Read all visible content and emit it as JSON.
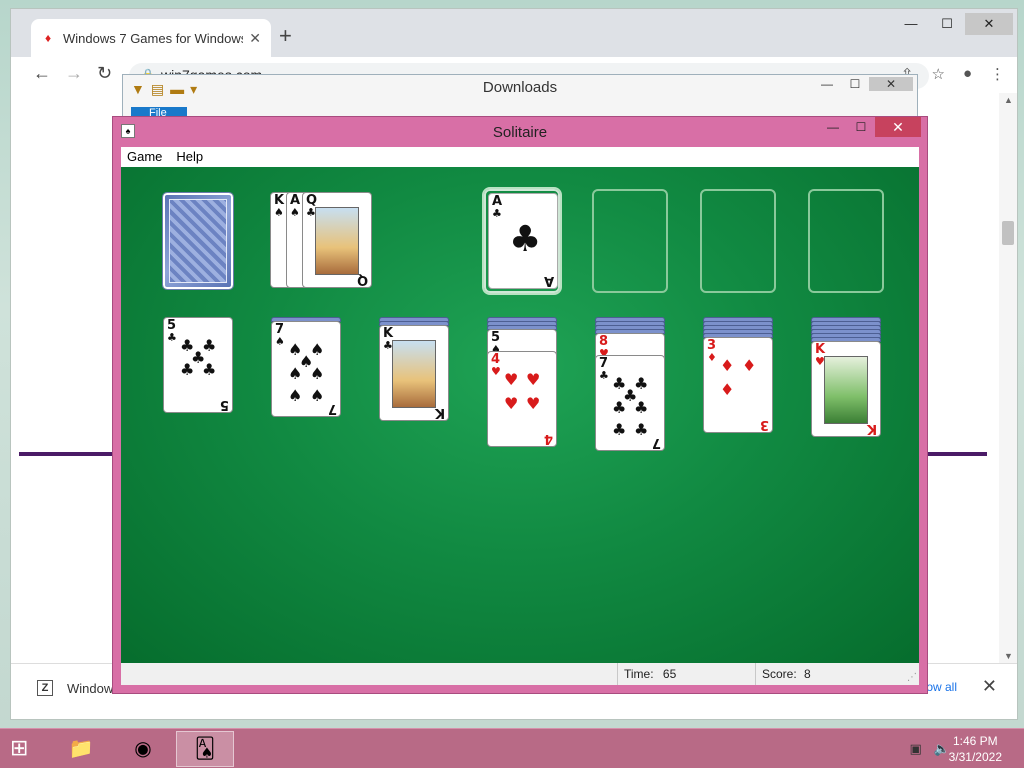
{
  "browser": {
    "tab_title": "Windows 7 Games for Windows",
    "tab_close": "✕",
    "new_tab": "+",
    "url": "win7games.com",
    "download_item": "Windows",
    "show_all": "Show all",
    "download_close": "✕"
  },
  "explorer": {
    "title": "Downloads",
    "file_tab": "File"
  },
  "solitaire": {
    "title": "Solitaire",
    "menu": [
      "Game",
      "Help"
    ],
    "status": {
      "time_label": "Time:",
      "time_value": "65",
      "score_label": "Score:",
      "score_value": "8"
    },
    "waste": [
      {
        "rank": "K",
        "suit": "♠"
      },
      {
        "rank": "A",
        "suit": "♠"
      },
      {
        "rank": "Q",
        "suit": "♣"
      }
    ],
    "foundation": [
      {
        "rank": "A",
        "suit": "♣"
      }
    ],
    "tableau": [
      {
        "hidden": 0,
        "cards": [
          {
            "rank": "5",
            "suit": "♣"
          }
        ]
      },
      {
        "hidden": 1,
        "cards": [
          {
            "rank": "7",
            "suit": "♠"
          }
        ]
      },
      {
        "hidden": 2,
        "cards": [
          {
            "rank": "K",
            "suit": "♣"
          }
        ]
      },
      {
        "hidden": 3,
        "cards": [
          {
            "rank": "5",
            "suit": "♠"
          },
          {
            "rank": "4",
            "suit": "♥"
          }
        ]
      },
      {
        "hidden": 4,
        "cards": [
          {
            "rank": "8",
            "suit": "♥"
          },
          {
            "rank": "7",
            "suit": "♣"
          }
        ]
      },
      {
        "hidden": 5,
        "cards": [
          {
            "rank": "3",
            "suit": "♦"
          }
        ]
      },
      {
        "hidden": 6,
        "cards": [
          {
            "rank": "K",
            "suit": "♥"
          }
        ]
      }
    ]
  },
  "taskbar": {
    "time": "1:46 PM",
    "date": "3/31/2022"
  }
}
